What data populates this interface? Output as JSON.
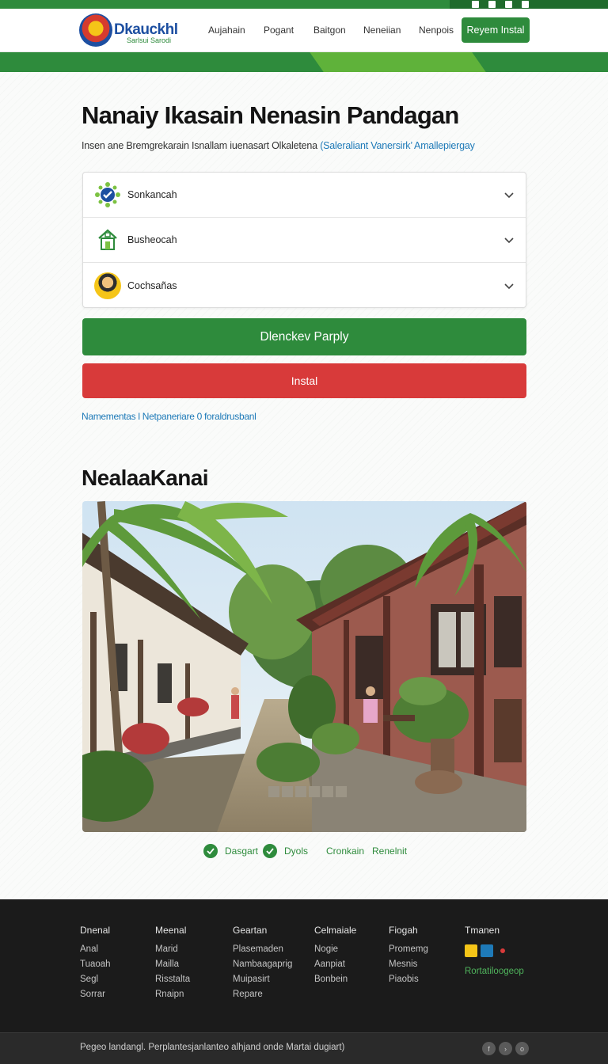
{
  "header": {
    "logo": {
      "wordmark": "Dkauckhl",
      "tagline": "Sarlsui Sarodi"
    },
    "nav": [
      "Aujahain",
      "Pogant",
      "Baitgon",
      "Neneiian",
      "Nenpois"
    ],
    "cta_label": "Reyem Instal"
  },
  "main": {
    "title": "Nanaiy Ikasain Nenasin Pandagan",
    "subtitle_text": "Insen ane Bremgrekarain Isnallam iuenasart Olkaletena",
    "subtitle_link": "(Saleraliant Vanersirk’ Amallepiergay",
    "accordion": [
      {
        "label": "Sonkancah",
        "icon": "gear-emblem-icon"
      },
      {
        "label": "Busheocah",
        "icon": "house-icon"
      },
      {
        "label": "Cochsañas",
        "icon": "person-avatar-icon"
      }
    ],
    "primary_button": "Dlenckev Parply",
    "danger_button": "Instal",
    "help_link": "Namementas l Netpaneriare 0 foraldrusbanl",
    "gallery_title": "NealaaKanai",
    "features": [
      "Dasgart",
      "Dyols",
      "Cronkain",
      "Renelnit"
    ]
  },
  "footer": {
    "columns": [
      {
        "heading": "Dnenal",
        "items": [
          "Anal",
          "Tuaoah",
          "Segl",
          "Sorrar"
        ]
      },
      {
        "heading": "Meenal",
        "items": [
          "Marid",
          "Mailla",
          "Risstalta",
          "Rnaipn"
        ]
      },
      {
        "heading": "Geartan",
        "items": [
          "Plasemaden",
          "Nambaagaprig",
          "Muipasirt",
          "Repare"
        ]
      },
      {
        "heading": "Celmaiale",
        "items": [
          "Nogie",
          "Aanpiat",
          "Bonbein"
        ]
      },
      {
        "heading": "Fiogah",
        "items": [
          "Promemg",
          "Mesnis",
          "Piaobis"
        ]
      },
      {
        "heading": "Tmanen",
        "items": [
          "Rortatiloogeop"
        ]
      }
    ],
    "copyright": "Pegeo landangl. Perplantesjanlanteo alhjand onde Martai dugiart)"
  },
  "colors": {
    "brand_green": "#2e8b3c",
    "accent_green": "#7cc242",
    "danger_red": "#d83a3a",
    "link_blue": "#1e7ab8",
    "footer_bg": "#1b1b1b"
  }
}
